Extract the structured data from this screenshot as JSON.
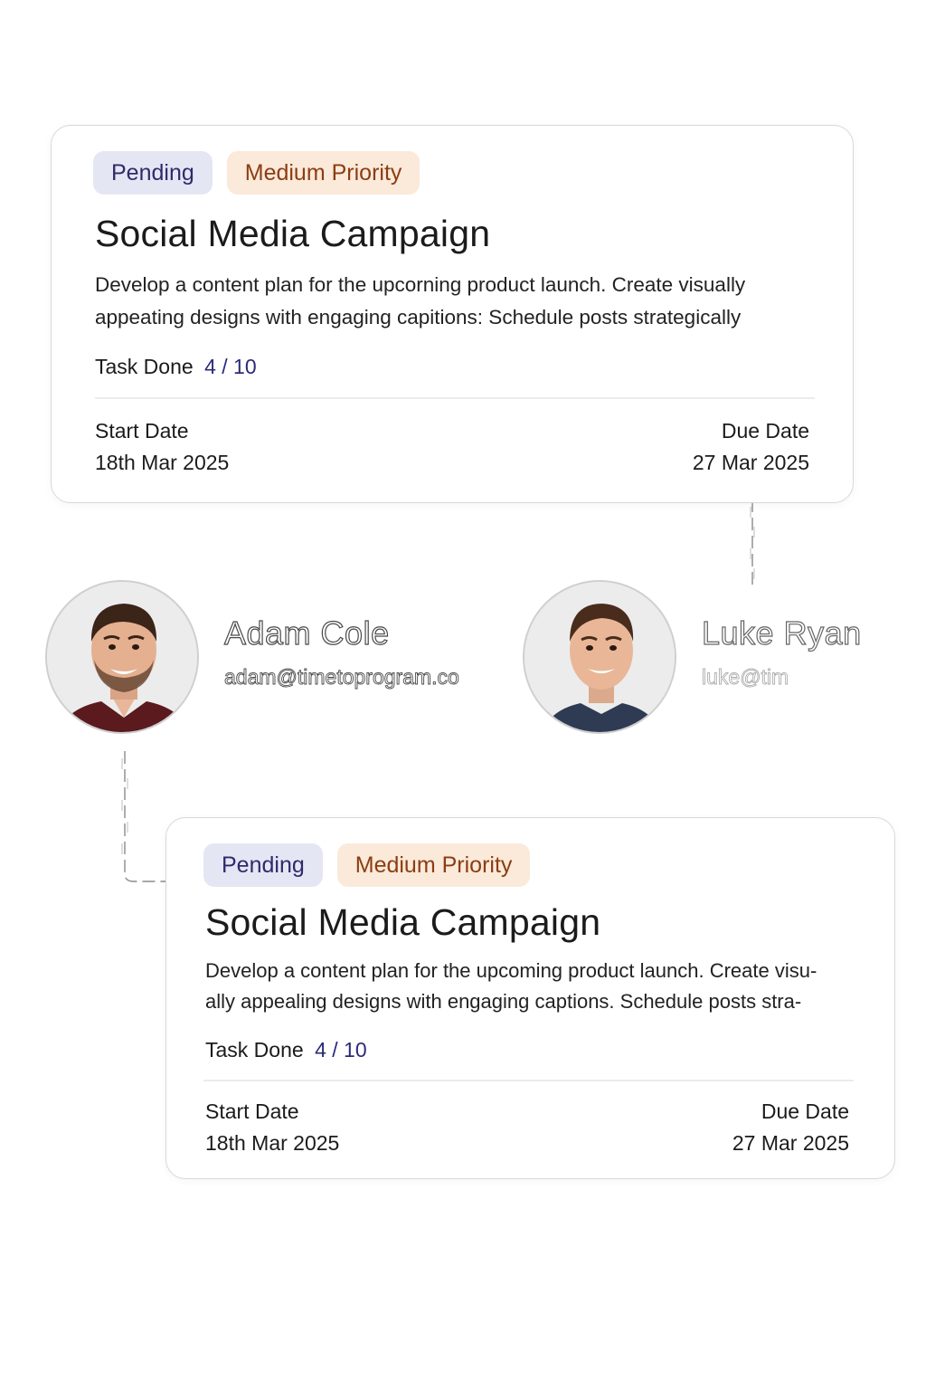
{
  "cards": [
    {
      "status": "Pending",
      "priority": "Medium Priority",
      "title": "Social Media Campaign",
      "description_lines": [
        "Develop a content plan for the upcorning product launch. Create visually",
        "appeating designs with engaging capitions: Schedule posts strategically"
      ],
      "task_done_label": "Task Done",
      "task_done_count": "4 / 10",
      "start_date_label": "Start Date",
      "start_date": "18th Mar 2025",
      "due_date_label": "Due Date",
      "due_date": "27 Mar 2025"
    },
    {
      "status": "Pending",
      "priority": "Medium Priority",
      "title": "Social Media Campaign",
      "description_lines": [
        "Develop a content plan for the upcoming product launch. Create visu-",
        "ally appealing designs with engaging captions. Schedule posts stra-"
      ],
      "task_done_label": "Task Done",
      "task_done_count": "4 / 10",
      "start_date_label": "Start Date",
      "start_date": "18th Mar 2025",
      "due_date_label": "Due Date",
      "due_date": "27 Mar 2025"
    }
  ],
  "people": [
    {
      "name": "Adam Cole",
      "email": "adam@timetoprogram.co"
    },
    {
      "name": "Luke Ryan",
      "email": "luke@tim"
    }
  ],
  "colors": {
    "pending_bg": "#e5e6f4",
    "pending_text": "#2e2b6a",
    "priority_bg": "#fbe9da",
    "priority_text": "#8a3e12",
    "count_text": "#2c2a7a"
  }
}
